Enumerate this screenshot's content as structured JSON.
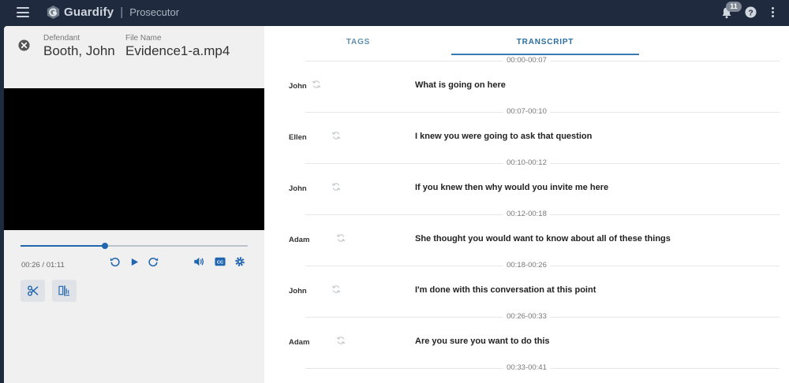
{
  "app": {
    "name": "Guardify",
    "role": "Prosecutor"
  },
  "header": {
    "notification_count": "11"
  },
  "case": {
    "defendant_label": "Defendant",
    "defendant_name": "Booth, John",
    "file_label": "File Name",
    "file_name": "Evidence1-a.mp4"
  },
  "player": {
    "time_display": "00:26 / 01:11",
    "progress": 0.37
  },
  "tabs": {
    "tags": "TAGS",
    "transcript": "TRANSCRIPT",
    "active": "transcript"
  },
  "transcript": [
    {
      "range": "00:00-00:07",
      "speaker": "John",
      "text": "What is going on here"
    },
    {
      "range": "00:07-00:10",
      "speaker": "Ellen",
      "text": "I knew you were going to ask that question"
    },
    {
      "range": "00:10-00:12",
      "speaker": "John",
      "text": "If you knew then why would you invite me here"
    },
    {
      "range": "00:12-00:18",
      "speaker": "Adam",
      "text": "She thought you would want to know about all of these things"
    },
    {
      "range": "00:18-00:26",
      "speaker": "John",
      "text": "I'm done with this conversation at this point"
    },
    {
      "range": "00:26-00:33",
      "speaker": "Adam",
      "text": "Are you sure you want to do this"
    }
  ],
  "transcript_next_range": "00:33-00:41",
  "colors": {
    "accent": "#2166b0",
    "topbar": "#1f2a3e",
    "panel": "#f0f0f1"
  },
  "icons": [
    "menu-icon",
    "guardify-logo-icon",
    "bell-icon",
    "help-icon",
    "more-vert-icon",
    "close-circle-icon",
    "rewind-icon",
    "play-icon",
    "forward-icon",
    "volume-icon",
    "closed-caption-icon",
    "settings-icon",
    "scissors-icon",
    "clip-marker-icon",
    "sync-icon"
  ]
}
